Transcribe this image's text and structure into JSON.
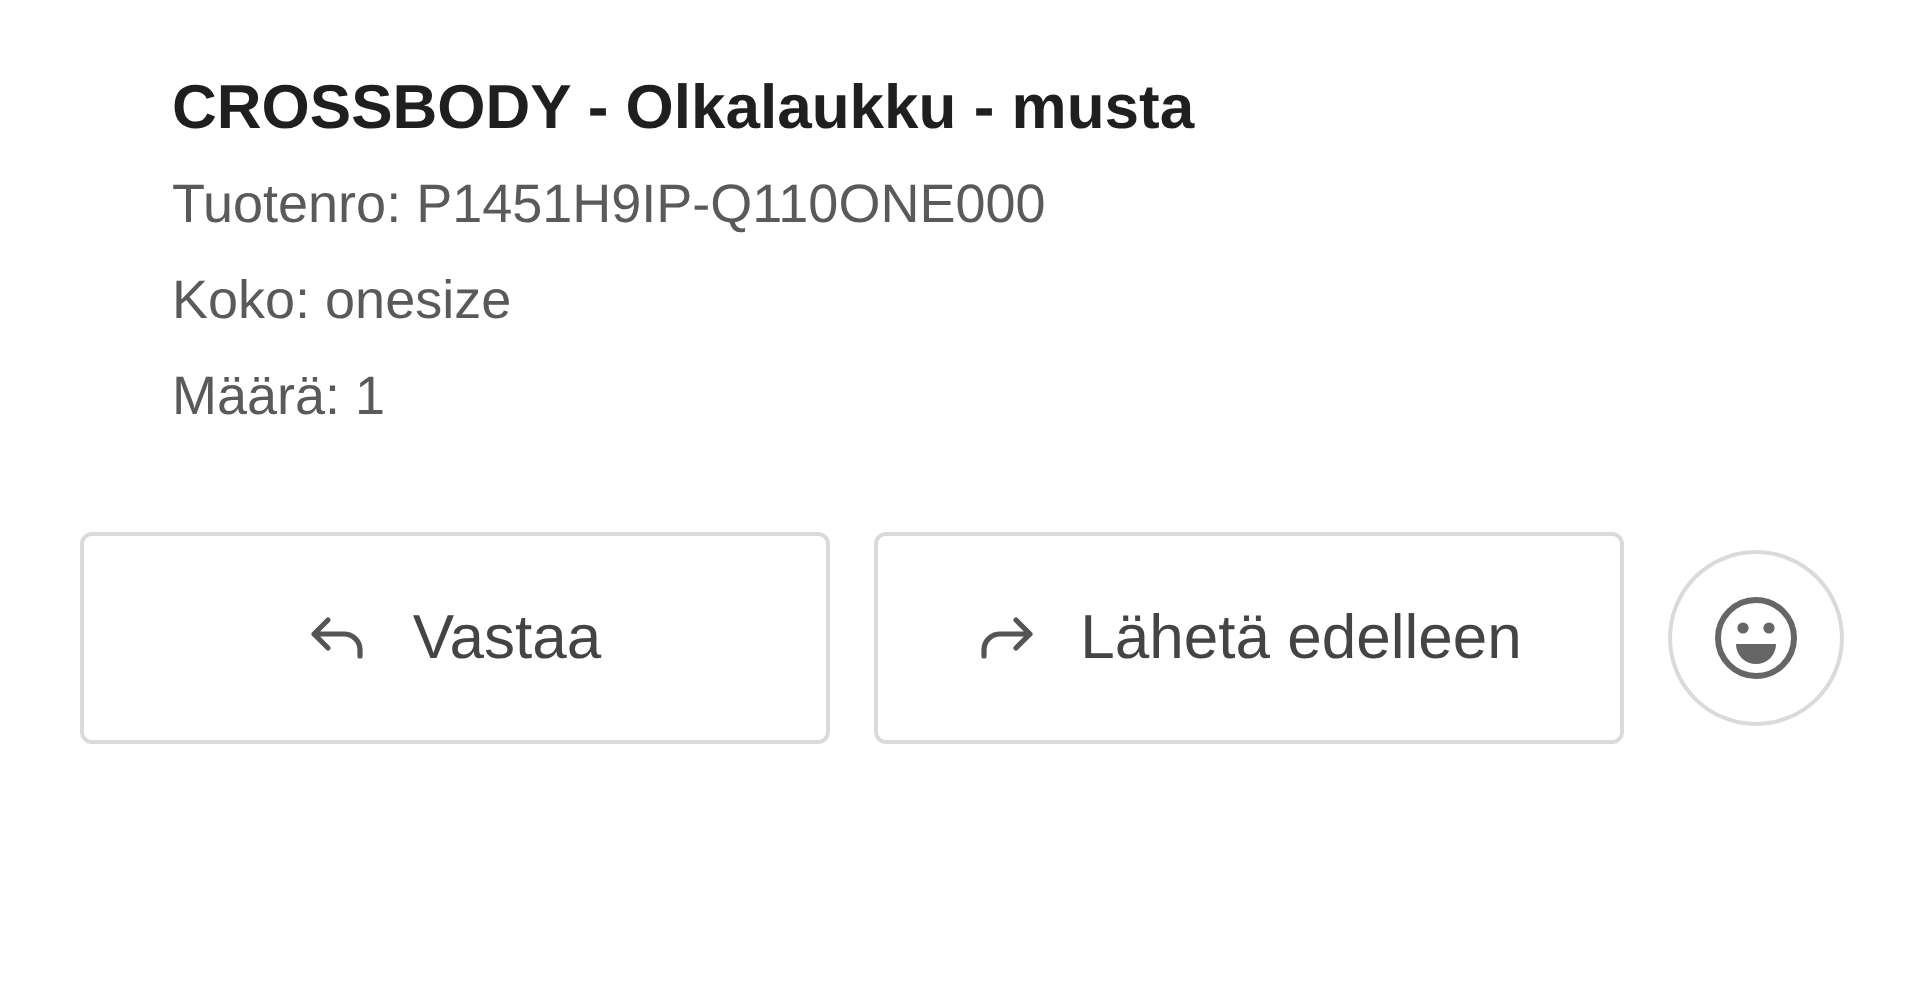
{
  "product": {
    "title": "CROSSBODY - Olkalaukku - musta",
    "details": [
      "Tuotenro: P1451H9IP-Q110ONE000",
      "Koko: onesize",
      "Määrä: 1"
    ]
  },
  "actions": [
    {
      "kind": "reply",
      "label": "Vastaa"
    },
    {
      "kind": "forward",
      "label": "Lähetä edelleen"
    }
  ],
  "emoji_button": {
    "kind": "smiley"
  }
}
